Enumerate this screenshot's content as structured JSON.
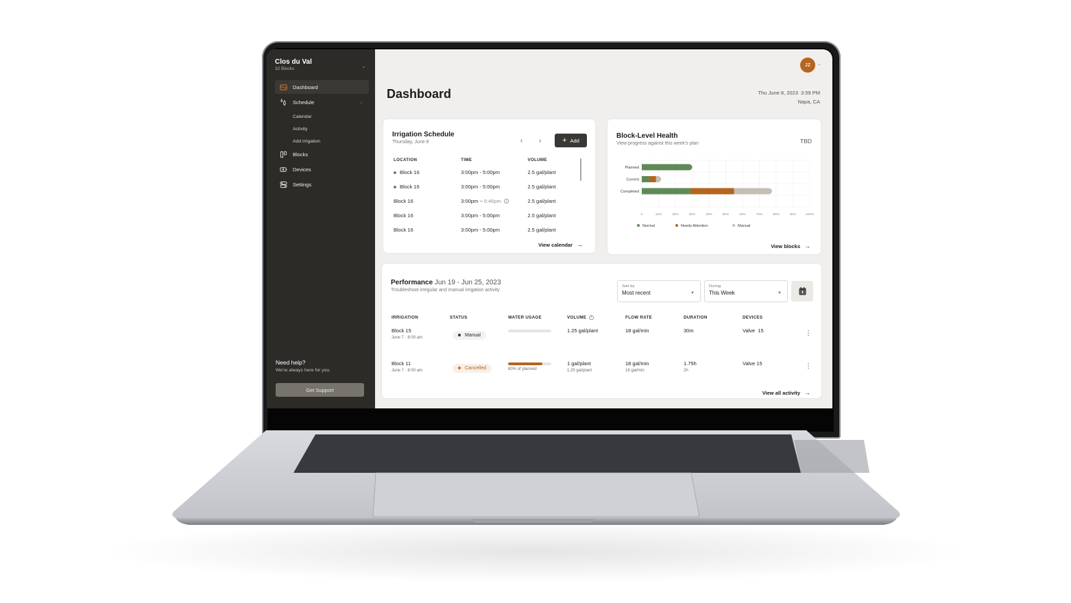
{
  "sidebar": {
    "org_name": "Clos du Val",
    "org_sub": "32 Blocks",
    "nav": [
      {
        "label": "Dashboard",
        "icon": "dashboard-icon",
        "active": true
      },
      {
        "label": "Schedule",
        "icon": "water-drops-icon",
        "expandable": true
      },
      {
        "label": "Blocks",
        "icon": "blocks-icon"
      },
      {
        "label": "Devices",
        "icon": "devices-icon"
      },
      {
        "label": "Settings",
        "icon": "settings-icon"
      }
    ],
    "schedule_sub": [
      "Calendar",
      "Activity",
      "Add irrigation"
    ],
    "help_title": "Need help?",
    "help_sub": "We're always here for you.",
    "support_button": "Get Support"
  },
  "header": {
    "avatar_initials": "JZ",
    "title": "Dashboard",
    "datetime": "Thu June 8, 2023  3:59 PM",
    "location": "Napa, CA"
  },
  "schedule": {
    "title": "Irrigation Schedule",
    "date": "Thursday, June 8",
    "add_label": "Add",
    "columns": [
      "LOCATION",
      "TIME",
      "VOLUME"
    ],
    "rows": [
      {
        "location": "Block 16",
        "active": true,
        "time_start": "3:00pm - 5:00pm",
        "time_end": "",
        "volume": "2.5 gal/plant"
      },
      {
        "location": "Block 16",
        "active": true,
        "time_start": "3:00pm - 5:00pm",
        "time_end": "",
        "volume": "2.5 gal/plant"
      },
      {
        "location": "Block 16",
        "active": false,
        "time_start": "3:00pm ~ ",
        "time_end": "6:46pm",
        "volume": "2.5 gal/plant",
        "info": true
      },
      {
        "location": "Block 16",
        "active": false,
        "time_start": "3:00pm - 5:00pm",
        "time_end": "",
        "volume": "2.5 gal/plant"
      },
      {
        "location": "Block 16",
        "active": false,
        "time_start": "3:00pm - 5:00pm",
        "time_end": "",
        "volume": "2.5 gal/plant"
      }
    ],
    "link": "View calendar"
  },
  "health": {
    "title": "Block-Level Health",
    "subtitle": "View progress against this week's plan",
    "badge": "TBD",
    "link": "View blocks"
  },
  "chart_data": {
    "type": "bar",
    "orientation": "horizontal",
    "stacked": true,
    "title": "Block-Level Health",
    "categories": [
      "Planned",
      "Current",
      "Completed"
    ],
    "series": [
      {
        "name": "Normal",
        "color": "#5f8a57",
        "values": [
          30,
          4.5,
          29
        ]
      },
      {
        "name": "Needs Attention",
        "color": "#b4651f",
        "values": [
          0,
          4,
          26
        ]
      },
      {
        "name": "Manual",
        "color": "#c4beb7",
        "values": [
          0,
          3,
          22.5
        ]
      }
    ],
    "xlim": [
      0,
      100
    ],
    "xticks": [
      "0",
      "10%",
      "20%",
      "30%",
      "40%",
      "50%",
      "60%",
      "70%",
      "80%",
      "90%",
      "100%"
    ],
    "grid": true,
    "legend": "bottom"
  },
  "performance": {
    "title": "Performance",
    "range": "Jun 19 - Jun 25, 2023",
    "subtitle": "Troubleshoot irregular and manual irrigation activity",
    "sort": {
      "label": "Sort by",
      "value": "Most recent"
    },
    "during": {
      "label": "During",
      "value": "This Week"
    },
    "columns": [
      "IRRIGATION",
      "STATUS",
      "WATER USAGE",
      "VOLUME",
      "FLOW RATE",
      "DURATION",
      "DEVICES"
    ],
    "rows": [
      {
        "block": "Block 15",
        "when": "June 7 · 8:00 am",
        "status": "Manual",
        "status_type": "manual",
        "usage_pct": 0,
        "usage_label": "",
        "volume": "1.25 gal/plant",
        "volume_sub": "",
        "flow": "18 gal/min",
        "flow_sub": "",
        "duration": "30m",
        "duration_sub": "",
        "device": "Valve  15"
      },
      {
        "block": "Block 11",
        "when": "June 7 · 8:00 am",
        "status": "Cancelled",
        "status_type": "cancel",
        "usage_pct": 80,
        "usage_label": "80% of planned",
        "volume": "1 gal/plant",
        "volume_sub": "1.25 gal/plant",
        "flow": "18 gal/min",
        "flow_sub": "18 gal/min",
        "duration": "1.75h",
        "duration_sub": "2h",
        "device": "Valve 15"
      }
    ],
    "link": "View all activity"
  },
  "colors": {
    "sidebar": "#2d2b28",
    "accent": "#b4651f",
    "normal": "#5f8a57",
    "manual": "#c4beb7"
  }
}
